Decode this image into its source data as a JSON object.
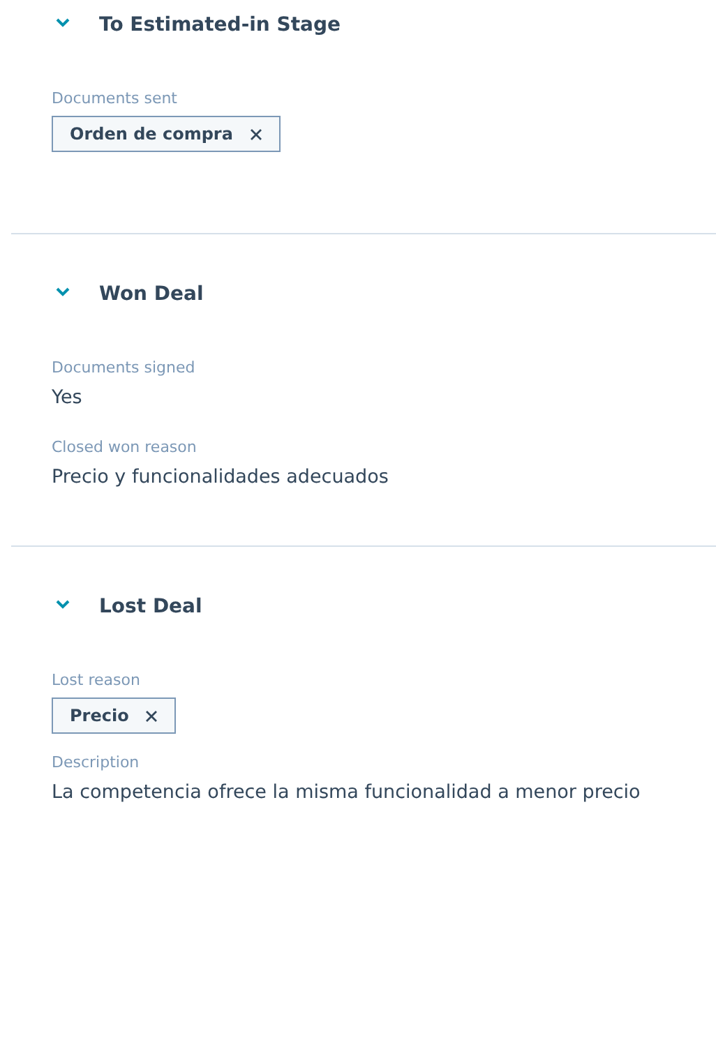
{
  "sections": [
    {
      "title": "To Estimated-in Stage",
      "expanded": true,
      "fields": [
        {
          "label": "Documents sent",
          "kind": "tags",
          "tags": [
            "Orden de compra"
          ]
        }
      ]
    },
    {
      "title": "Won Deal",
      "expanded": true,
      "fields": [
        {
          "label": "Documents signed",
          "kind": "text",
          "value": "Yes"
        },
        {
          "label": "Closed won reason",
          "kind": "text",
          "value": "Precio y funcionalidades adecuados"
        }
      ]
    },
    {
      "title": "Lost Deal",
      "expanded": true,
      "fields": [
        {
          "label": "Lost reason",
          "kind": "tags",
          "tags": [
            "Precio"
          ]
        },
        {
          "label": "Description",
          "kind": "text",
          "value": "La competencia ofrece la misma funcionalidad a menor precio"
        }
      ]
    }
  ]
}
